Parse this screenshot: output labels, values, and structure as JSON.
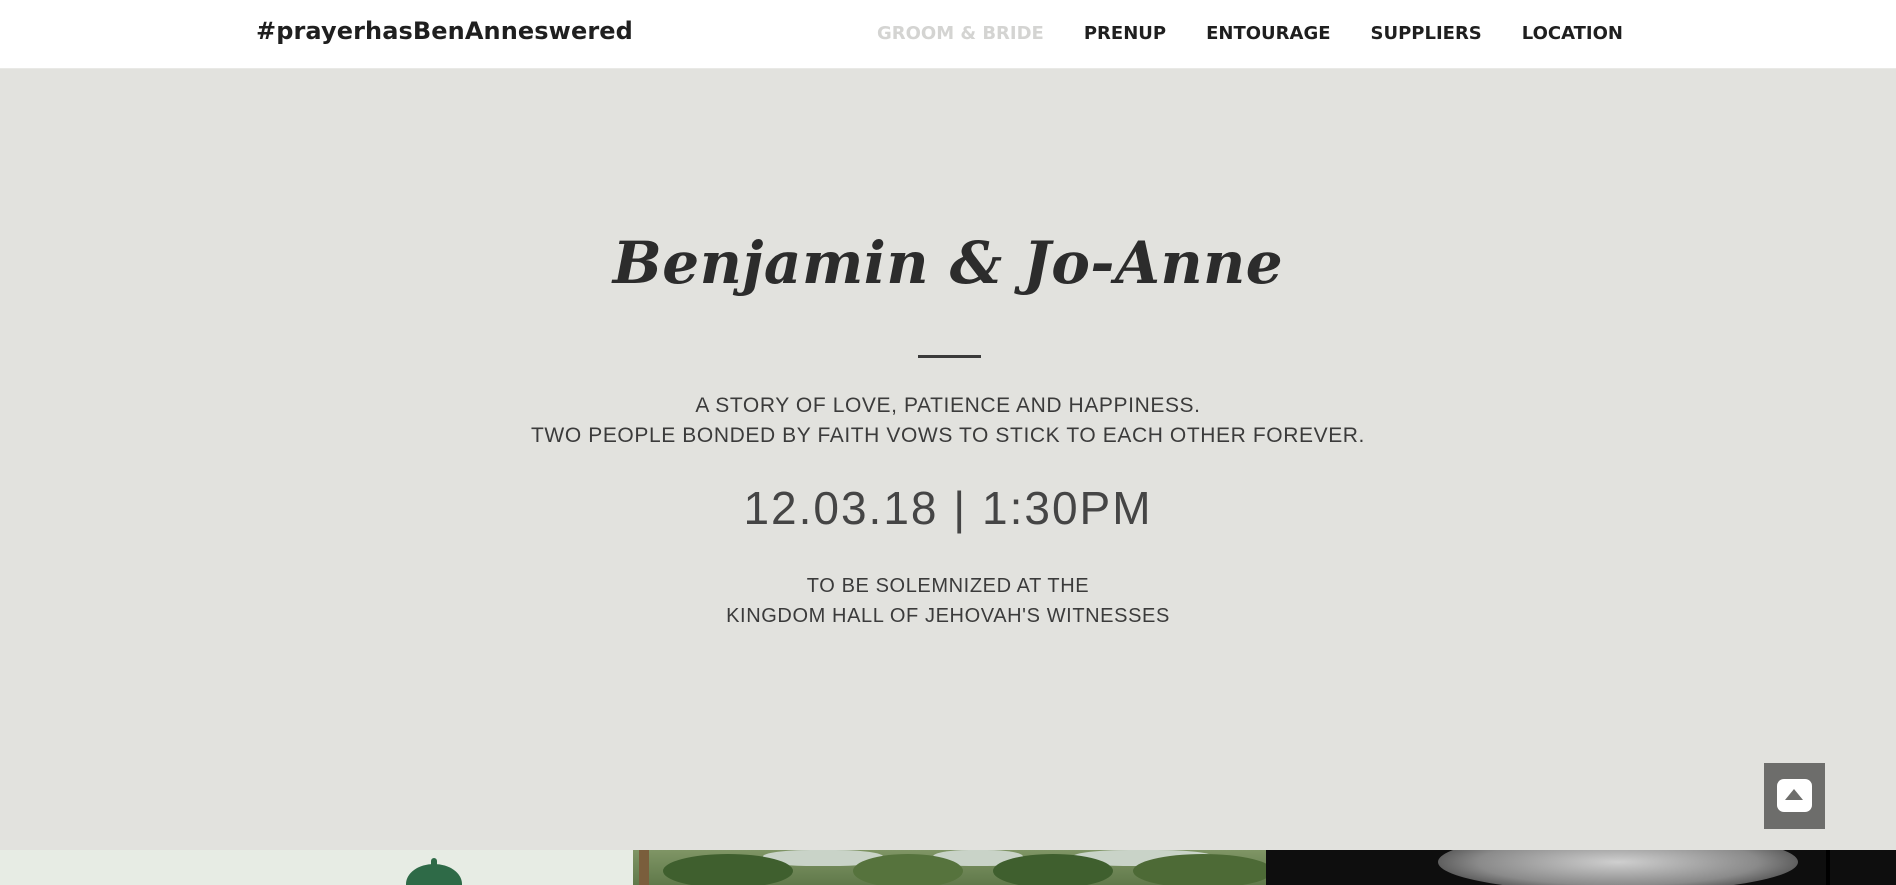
{
  "nav": {
    "brand": "#prayerhasBenAnneswered",
    "links": [
      {
        "label": "GROOM & BRIDE",
        "active": true
      },
      {
        "label": "PRENUP",
        "active": false
      },
      {
        "label": "ENTOURAGE",
        "active": false
      },
      {
        "label": "SUPPLIERS",
        "active": false
      },
      {
        "label": "LOCATION",
        "active": false
      }
    ]
  },
  "hero": {
    "title": "Benjamin & Jo-Anne",
    "tagline": [
      "A STORY OF LOVE, PATIENCE AND HAPPINESS.",
      "TWO PEOPLE BONDED BY FAITH VOWS TO STICK TO EACH OTHER FOREVER."
    ],
    "datetime": "12.03.18 | 1:30PM",
    "venue": [
      "TO BE SOLEMNIZED AT THE",
      "KINGDOM HALL OF JEHOVAH'S WITNESSES"
    ]
  },
  "scroll_top": {
    "icon": "arrow-up-icon"
  },
  "colors": {
    "hero_background": "#e2e2de",
    "nav_active": "#d4d4d2",
    "nav_text": "#1f1f1f",
    "scroll_button": "#6d6d6b"
  }
}
